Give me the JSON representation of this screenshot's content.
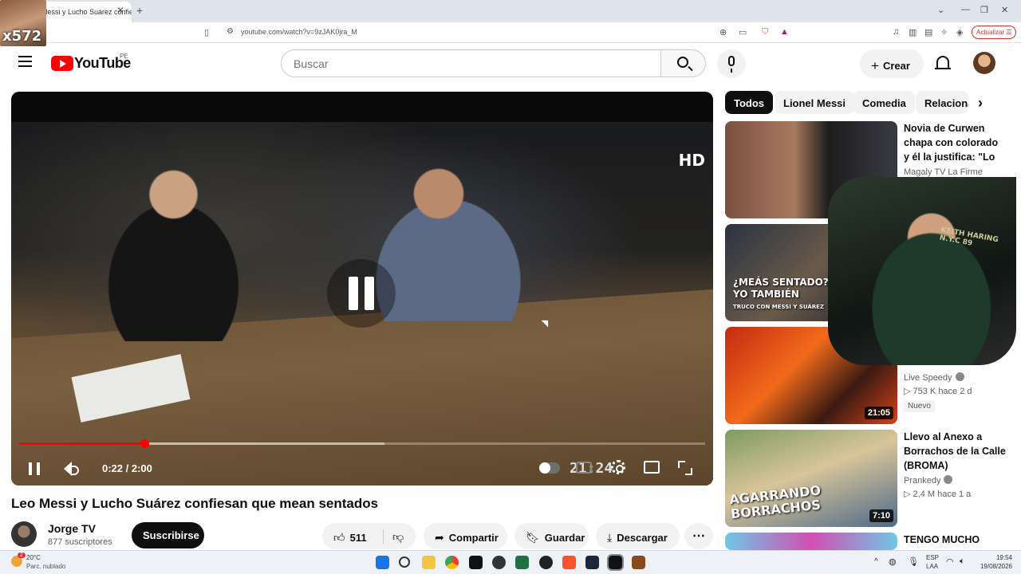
{
  "browser": {
    "tab_title": "Messi y Lucho Suárez confiesan",
    "tab_close": "✕",
    "new_tab": "+",
    "url": "youtube.com/watch?v=9zJAK0jra_M",
    "update_label": "Actualizar",
    "overlay_label": "x572"
  },
  "header": {
    "wordmark": "YouTube",
    "country": "PE",
    "search_placeholder": "Buscar",
    "create_label": "Crear"
  },
  "player": {
    "hd": "HD",
    "burned_time": "21:24",
    "time": "0:22 / 2:00",
    "progress_fraction": 0.183,
    "buffer_fraction": 0.533
  },
  "video": {
    "title": "Leo Messi y Lucho Suárez confiesan que mean sentados",
    "channel": "Jorge TV",
    "subscribers": "877 suscriptores",
    "subscribe_label": "Suscribirse",
    "likes": "511",
    "share_label": "Compartir",
    "save_label": "Guardar",
    "download_label": "Descargar",
    "more_label": "⋯"
  },
  "chips": [
    "Todos",
    "Lionel Messi",
    "Comedia",
    "Relacionados"
  ],
  "recommendations": [
    {
      "title": "Novia de Curwen chapa con colorado y él la justifica: \"Lo es...",
      "channel": "Magaly TV La Firme",
      "meta": "",
      "duration": ""
    },
    {
      "title": "",
      "channel": "",
      "meta": "",
      "duration": "",
      "thumb_text": "¿MEÁS SENTADO? YO TAMBIÉN",
      "thumb_sub": "TRUCO CON MESSI Y SUÁREZ"
    },
    {
      "title": "",
      "channel": "Live Speedy",
      "meta": "▷ 753 K   hace 2 d",
      "duration": "21:05",
      "badge": "Nuevo"
    },
    {
      "title": "Llevo al Anexo a Borrachos de la Calle (BROMA)",
      "channel": "Prankedy",
      "meta": "▷ 2,4 M   hace 1 a",
      "duration": "7:10",
      "thumb_text": "AGARRANDO BORRACHOS"
    },
    {
      "title": "TENGO MUCHO DRIP",
      "channel": "",
      "meta": "",
      "duration": ""
    }
  ],
  "webcam": {
    "shirt_text": "KEITH HARING N.Y.C 89"
  },
  "taskbar": {
    "temp": "20°C",
    "weather": "Parc. nublado",
    "lang": "ESP",
    "layout": "LAA",
    "time": "19:54",
    "date": "19/08/2026",
    "notification_count": "2"
  },
  "colors": {
    "accent": "#ff0000",
    "chip_active": "#0f0f0f"
  }
}
